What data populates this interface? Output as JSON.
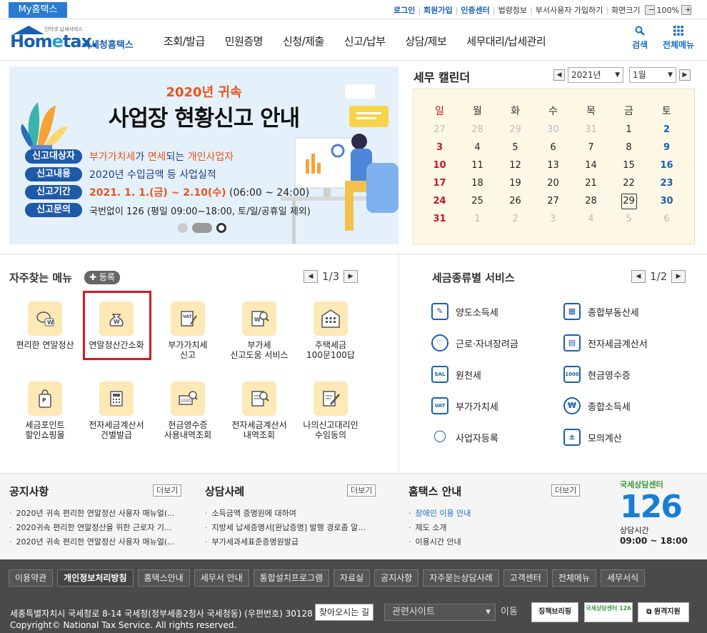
{
  "topbar": {
    "myhometax": "My홈택스",
    "links": [
      "로그인",
      "회원가입",
      "인증센터",
      "법령정보",
      "부서사용자 가입하기",
      "화면크기"
    ],
    "zoom_minus": "−",
    "zoom_value": "100%",
    "zoom_plus": "+"
  },
  "header": {
    "logo_small": "인터넷 납세서비스",
    "logo_home": "Hom",
    "logo_e": "e",
    "logo_tax": "tax.",
    "logo_nts": "국세청홈택스",
    "nav": [
      "조회/발급",
      "민원증명",
      "신청/제출",
      "신고/납부",
      "상담/제보",
      "세무대리/납세관리"
    ],
    "search_label": "검색",
    "allmenu_label": "전체메뉴"
  },
  "banner": {
    "year_label": "2020년 귀속",
    "title": "사업장 현황신고 안내",
    "rows": [
      {
        "tag": "신고대상자",
        "parts": [
          "부가가치세",
          "가 ",
          "면세",
          "되는 ",
          "개인사업자"
        ]
      },
      {
        "tag": "신고내용",
        "text": "2020년 수입금액 등 사업실적"
      },
      {
        "tag": "신고기간",
        "period": "2021. 1. 1.(금) ~ 2.10(수)",
        "time": " (06:00 ~ 24:00)"
      },
      {
        "tag": "신고문의",
        "text": "국번없이 126 (평일 09:00~18:00, 토/일/공휴일 제외)"
      }
    ]
  },
  "calendar": {
    "title": "세무 캘린더",
    "year": "2021년",
    "month": "1월",
    "weekdays": [
      "일",
      "월",
      "화",
      "수",
      "목",
      "금",
      "토"
    ],
    "weeks": [
      [
        "27",
        "28",
        "29",
        "30",
        "31",
        "1",
        "2"
      ],
      [
        "3",
        "4",
        "5",
        "6",
        "7",
        "8",
        "9"
      ],
      [
        "10",
        "11",
        "12",
        "13",
        "14",
        "15",
        "16"
      ],
      [
        "17",
        "18",
        "19",
        "20",
        "21",
        "22",
        "23"
      ],
      [
        "24",
        "25",
        "26",
        "27",
        "28",
        "29",
        "30"
      ],
      [
        "31",
        "1",
        "2",
        "3",
        "4",
        "5",
        "6"
      ]
    ],
    "today": "29"
  },
  "favorites": {
    "title": "자주찾는 메뉴",
    "add_label": "등록",
    "page": "1/3",
    "items": [
      {
        "label": "편리한 연말정산",
        "icon": "coin-w-icon"
      },
      {
        "label": "연말정산간소화",
        "icon": "money-bag-icon"
      },
      {
        "label": "부가가치세\n신고",
        "icon": "vat-doc-icon"
      },
      {
        "label": "부가세\n신고도움 서비스",
        "icon": "doc-search-icon"
      },
      {
        "label": "주택세금\n100문100답",
        "icon": "building-icon"
      },
      {
        "label": "세금포인트\n할인쇼핑몰",
        "icon": "shopping-bag-icon"
      },
      {
        "label": "전자세금계산서\n건별발급",
        "icon": "calculator-icon"
      },
      {
        "label": "현금영수증\n사용내역조회",
        "icon": "receipt-search-icon"
      },
      {
        "label": "전자세금계산서\n내역조회",
        "icon": "doc-search-icon"
      },
      {
        "label": "나의신고대리인\n수임동의",
        "icon": "doc-edit-icon"
      }
    ]
  },
  "services": {
    "title": "세금종류별 서비스",
    "page": "1/2",
    "items": [
      {
        "label": "양도소득세",
        "icon": "transfer-icon",
        "glyph": "✎"
      },
      {
        "label": "종합부동산세",
        "icon": "real-estate-icon",
        "glyph": "▦"
      },
      {
        "label": "근로·자녀장려금",
        "icon": "heart-hand-icon",
        "glyph": "♡"
      },
      {
        "label": "전자세금계산서",
        "icon": "calculator-icon",
        "glyph": "▤"
      },
      {
        "label": "원천세",
        "icon": "salary-doc-icon",
        "glyph": "SAL"
      },
      {
        "label": "현금영수증",
        "icon": "cash-receipt-icon",
        "glyph": "1000"
      },
      {
        "label": "부가가치세",
        "icon": "vat-icon",
        "glyph": "VAT"
      },
      {
        "label": "종합소득세",
        "icon": "money-bag-icon",
        "glyph": "₩"
      },
      {
        "label": "사업자등록",
        "icon": "person-icon",
        "glyph": "◯"
      },
      {
        "label": "모의계산",
        "icon": "calc-icon",
        "glyph": "±"
      }
    ]
  },
  "notices": {
    "title": "공지사항",
    "more": "더보기",
    "items": [
      "2020년 귀속 편리한 연말정산 사용자 매뉴얼(...",
      "2020귀속 편리한 연말정산을 위한 근로자 기...",
      "2020년 귀속 편리한 연말정산 사용자 매뉴얼(..."
    ]
  },
  "cases": {
    "title": "상담사례",
    "more": "더보기",
    "items": [
      "소득금액 증명원에 대하여",
      "지방세 납세증명서[완납증명] 발행 경로좀 알...",
      "부가세과세표준증명원발급"
    ]
  },
  "guide": {
    "title": "홈택스 안내",
    "more": "더보기",
    "items": [
      "장애인 이용 안내",
      "제도 소개",
      "이용시간 안내"
    ]
  },
  "center126": {
    "top": "국세상담센터",
    "number": "126",
    "hours_label": "상담시간",
    "hours": "09:00 ~ 18:00"
  },
  "footer": {
    "links": [
      "이용약관",
      "개인정보처리방침",
      "홈택스안내",
      "세무서 안내",
      "통합설치프로그램",
      "자료실",
      "공지사항",
      "자주묻는상담사례",
      "고객센터",
      "전체메뉴",
      "세무서식"
    ],
    "address": "세종특별자치시 국세청로 8-14 국세청(정부세종2청사 국세청동) (우편번호) 30128",
    "find_button": "찾아오시는 길",
    "related": "관련사이트",
    "go": "이동",
    "badge1": "징책브리핑",
    "badge2": "국세상담센터 126",
    "badge3": "원격지원",
    "copyright": "Copyright© National Tax Service. All rights reserved."
  },
  "colors": {
    "brand_blue": "#1b5fad",
    "accent_orange": "#e8541c",
    "highlight_red": "#d71920",
    "sunday_red": "#c8151b",
    "saturday_blue": "#1a5fb4"
  }
}
